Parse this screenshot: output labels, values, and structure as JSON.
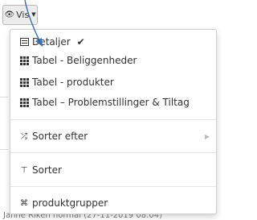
{
  "vis_button": {
    "label": "Vis",
    "icon": "eye-icon",
    "caret_icon": "caret-down-icon"
  },
  "menu": {
    "items": [
      {
        "label": "Detaljer",
        "icon": "list-icon",
        "checked": true,
        "check_glyph": "✔"
      },
      {
        "label": "Tabel - Beliggenheder",
        "icon": "table-grid-icon"
      },
      {
        "label": "Tabel - produkter",
        "icon": "table-grid-icon"
      },
      {
        "label": "Tabel – Problemstillinger & Tiltag",
        "icon": "table-grid-icon"
      },
      {
        "label": "Sorter efter",
        "icon": "shuffle-icon",
        "icon_glyph": "⤮",
        "has_submenu": true,
        "submenu_glyph": "▶"
      },
      {
        "label": "Sorter",
        "icon": "filter-icon",
        "icon_glyph": "⊤"
      },
      {
        "label": "produktgrupper",
        "icon": "group-object-icon",
        "icon_glyph": "⌘"
      }
    ]
  },
  "background": {
    "footer_text": "Janne Riken normal (27-11-2019 08:04)"
  },
  "colors": {
    "annotation_arrow": "#3a6fb5",
    "menu_border": "#cfcfcf",
    "button_bg": "#ececec"
  }
}
